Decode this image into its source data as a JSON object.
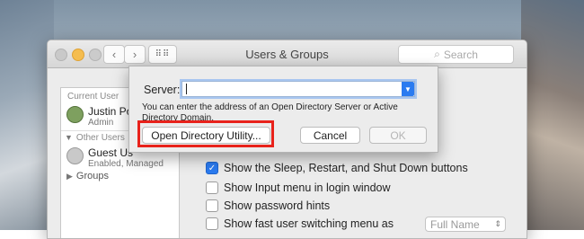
{
  "window": {
    "title": "Users & Groups",
    "search_placeholder": "Search"
  },
  "sidebar": {
    "current_user_header": "Current User",
    "current_user": {
      "name": "Justin Po",
      "role": "Admin"
    },
    "other_users_header": "Other Users",
    "guest_user": {
      "name": "Guest Us",
      "status": "Enabled, Managed"
    },
    "groups_label": "Groups"
  },
  "options": [
    {
      "label": "Show the Sleep, Restart, and Shut Down buttons",
      "checked": true
    },
    {
      "label": "Show Input menu in login window",
      "checked": false
    },
    {
      "label": "Show password hints",
      "checked": false
    },
    {
      "label": "Show fast user switching menu as",
      "checked": false
    }
  ],
  "fast_switch_select": {
    "value": "Full Name"
  },
  "dialog": {
    "server_label": "Server:",
    "server_value": "",
    "help_text": "You can enter the address of an Open Directory Server or Active Directory Domain.",
    "open_utility_button": "Open Directory Utility...",
    "cancel_button": "Cancel",
    "ok_button": "OK"
  },
  "icons": {
    "back": "chevron-left-icon",
    "forward": "chevron-right-icon",
    "grid": "grid-icon",
    "search": "search-icon",
    "dropdown": "chevron-down-icon",
    "checkmark": "checkmark-icon"
  },
  "colors": {
    "accent": "#2b7bf0",
    "highlight_box": "#e8221b"
  }
}
